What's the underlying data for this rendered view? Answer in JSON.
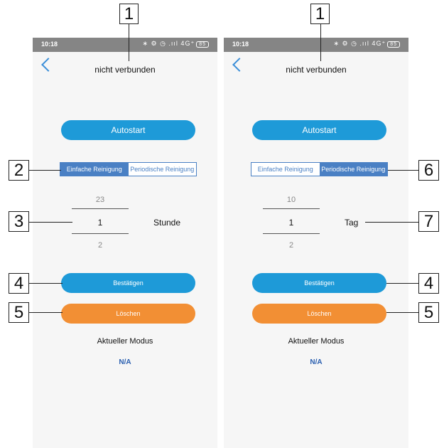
{
  "phones": [
    {
      "status_time": "10:18",
      "status_icons": "∗ ⚙ ◷ .ııl 4G⁺",
      "battery": "85",
      "title": "nicht verbunden",
      "autostart": "Autostart",
      "tabs": [
        {
          "label": "Einfache Reinigung",
          "active": true
        },
        {
          "label": "Periodische Reinigung",
          "active": false
        }
      ],
      "picker": {
        "prev": "23",
        "current": "1",
        "next": "2",
        "unit": "Stunde"
      },
      "confirm": "Bestätigen",
      "delete": "Löschen",
      "mode_label": "Aktueller Modus",
      "mode_value": "N/A"
    },
    {
      "status_time": "10:18",
      "status_icons": "∗ ⚙ ◷ .ııl 4G⁺",
      "battery": "85",
      "title": "nicht verbunden",
      "autostart": "Autostart",
      "tabs": [
        {
          "label": "Einfache Reinigung",
          "active": false
        },
        {
          "label": "Periodische Reinigung",
          "active": true
        }
      ],
      "picker": {
        "prev": "10",
        "current": "1",
        "next": "2",
        "unit": "Tag"
      },
      "confirm": "Bestätigen",
      "delete": "Löschen",
      "mode_label": "Aktueller Modus",
      "mode_value": "N/A"
    }
  ],
  "callouts": [
    "1",
    "1",
    "2",
    "3",
    "4",
    "5",
    "6",
    "7",
    "4",
    "5"
  ],
  "colors": {
    "accent_blue": "#1e9ad8",
    "tab_blue": "#4a80c4",
    "delete_orange": "#f28f34",
    "status_bar": "#858585"
  }
}
